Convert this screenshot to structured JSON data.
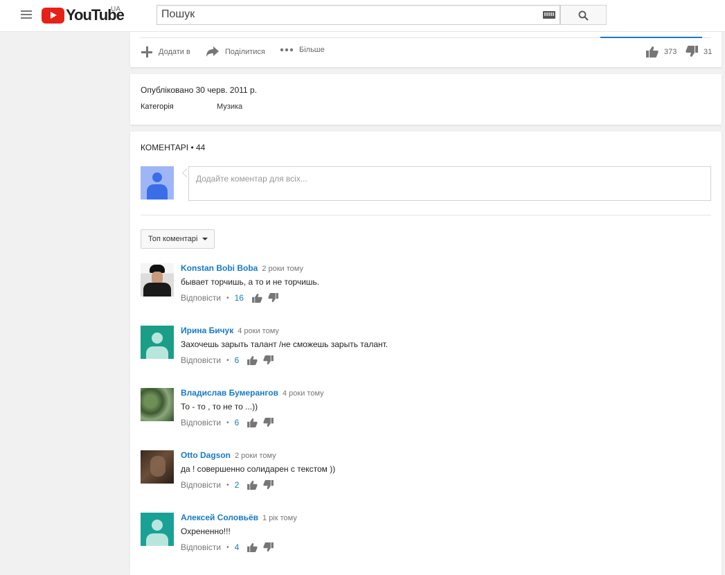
{
  "masthead": {
    "logo_text": "YouTube",
    "country": "UA",
    "search_placeholder": "Пошук"
  },
  "actions": {
    "add_label": "Додати в",
    "share_label": "Поділитися",
    "more_label": "Більше",
    "likes": "373",
    "dislikes": "31"
  },
  "info": {
    "published": "Опубліковано 30 черв. 2011 р.",
    "category_label": "Категорія",
    "category_value": "Музика"
  },
  "comments_section": {
    "header": "КОМЕНТАРІ • 44",
    "input_placeholder": "Додайте коментар для всіх...",
    "sort_label": "Топ коментарі",
    "reply_label": "Відповісти",
    "items": [
      {
        "author": "Konstan Bobi Boba",
        "time": "2 роки тому",
        "text": "бывает торчишь, а то и не торчишь.",
        "likes": "16"
      },
      {
        "author": "Ирина Бичук",
        "time": "4 роки тому",
        "text": "Захочешь зарыть талант /не сможешь зарыть талант.",
        "likes": "6"
      },
      {
        "author": "Владислав Бумерангов",
        "time": "4 роки тому",
        "text": "То - то , то не то ...))",
        "likes": "6"
      },
      {
        "author": "Otto Dagson",
        "time": "2 роки тому",
        "text": "да ! совершенно солидарен с текстом ))",
        "likes": "2"
      },
      {
        "author": "Алексей Соловьёв",
        "time": "1 рік тому",
        "text": "Охрененно!!!",
        "likes": "4"
      }
    ]
  }
}
